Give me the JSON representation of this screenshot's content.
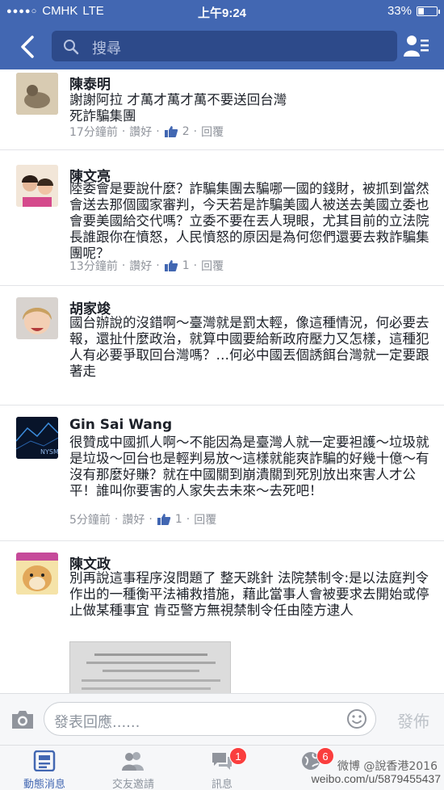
{
  "status": {
    "signal": "●●●●○",
    "carrier": "CMHK",
    "network": "LTE",
    "time": "上午9:24",
    "battery": "33%",
    "battery_level": 0.33
  },
  "search": {
    "placeholder": "搜尋"
  },
  "comments": [
    {
      "name": "陳泰明",
      "text": "謝謝阿拉 才萬才萬才萬不要送回台灣\n死詐騙集團",
      "time": "17分鐘前",
      "sep1": "·",
      "like_label": "讚好",
      "sep2": "·",
      "likes": "2",
      "sep3": "·",
      "reply_label": "回覆"
    },
    {
      "name": "陳文亮",
      "text": "陸委會是要說什麼？詐騙集團去騙哪一國的錢財，被抓到當然會送去那個國家審判，今天若是詐騙美國人被送去美國立委也會要美國給交代嗎？立委不要在丟人現眼，尤其目前的立法院長誰跟你在憤怒，人民憤怒的原因是為何您們還要去救詐騙集團呢？",
      "time": "13分鐘前",
      "sep1": "·",
      "like_label": "讚好",
      "sep2": "·",
      "likes": "1",
      "sep3": "·",
      "reply_label": "回覆"
    },
    {
      "name": "胡家竣",
      "text": "國台辦說的沒錯啊～臺灣就是罰太輕，像這種情況，何必要去報，還扯什麼政治，就算中國要給新政府壓力又怎樣，這種犯人有必要爭取回台灣嗎？…何必中國丟個誘餌台灣就一定要跟著走",
      "time": "",
      "likes": ""
    },
    {
      "name": "Gin Sai Wang",
      "text": "很贊成中國抓人啊～不能因為是臺灣人就一定要袒護～垃圾就是垃圾～回台也是輕判易放～這樣就能爽詐騙的好幾十億～有沒有那麼好賺？就在中國關到崩潰關到死別放出來害人才公平！誰叫你要害的人家失去未來～去死吧！",
      "time": "5分鐘前",
      "sep1": "·",
      "like_label": "讚好",
      "sep2": "·",
      "likes": "1",
      "sep3": "·",
      "reply_label": "回覆"
    },
    {
      "name": "陳文政",
      "text": "別再說這事程序沒問題了 整天跳針 法院禁制令:是以法庭判令作出的一種衡平法補救措施，藉此當事人會被要求去開始或停止做某種事宜 肯亞警方無視禁制令任由陸方逮人",
      "time": "",
      "likes": ""
    }
  ],
  "avatar_labels": {
    "gin_sai_wang": "NYSM"
  },
  "composer": {
    "placeholder": "發表回應......",
    "post_label": "發佈"
  },
  "tabs": [
    {
      "label": "動態消息",
      "badge": ""
    },
    {
      "label": "交友邀請",
      "badge": ""
    },
    {
      "label": "訊息",
      "badge": "1"
    },
    {
      "label": "",
      "badge": "6"
    },
    {
      "label": "",
      "badge": ""
    }
  ],
  "watermark": {
    "line1": "微博 @說香港2016",
    "line2": "weibo.com/u/5879455437"
  },
  "colors": {
    "brand": "#4267b2",
    "link": "#4267b2",
    "meta": "#90949c",
    "badge": "#fa3e3e"
  }
}
